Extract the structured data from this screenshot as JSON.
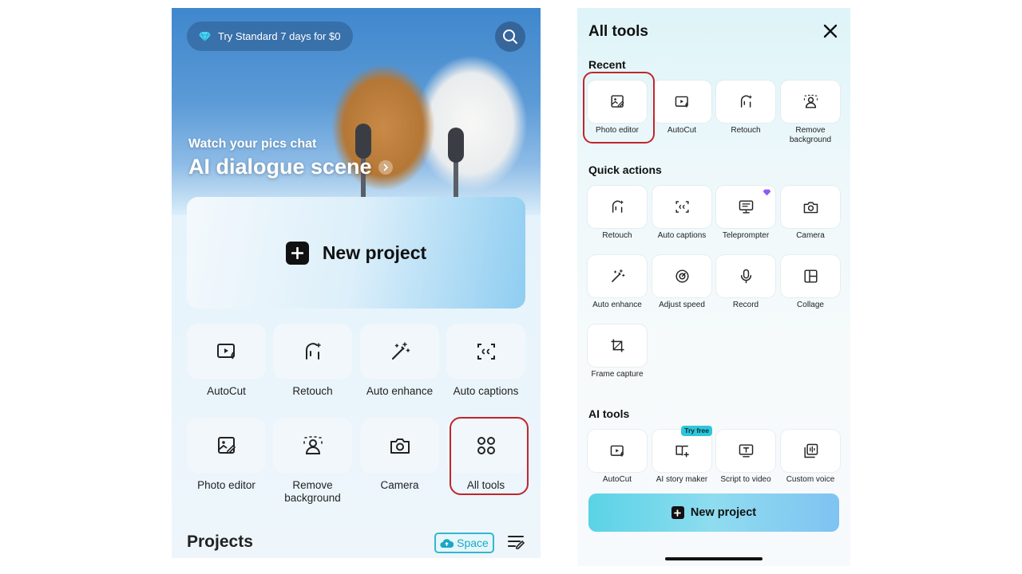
{
  "left": {
    "promo_text": "Try Standard 7 days for $0",
    "hero": {
      "subtitle": "Watch your pics chat",
      "title": "AI dialogue scene"
    },
    "new_project_label": "New project",
    "tools": [
      {
        "label": "AutoCut",
        "icon": "autocut-icon"
      },
      {
        "label": "Retouch",
        "icon": "retouch-icon"
      },
      {
        "label": "Auto enhance",
        "icon": "magic-wand-icon"
      },
      {
        "label": "Auto captions",
        "icon": "captions-icon"
      },
      {
        "label": "Photo editor",
        "icon": "photo-edit-icon"
      },
      {
        "label": "Remove background",
        "icon": "remove-bg-icon"
      },
      {
        "label": "Camera",
        "icon": "camera-icon"
      },
      {
        "label": "All tools",
        "icon": "grid-icon"
      }
    ],
    "projects_heading": "Projects",
    "space_label": "Space"
  },
  "right": {
    "title": "All tools",
    "sections": {
      "recent": "Recent",
      "quick_actions": "Quick actions",
      "ai_tools": "AI tools"
    },
    "recent": [
      {
        "label": "Photo editor",
        "icon": "photo-edit-icon"
      },
      {
        "label": "AutoCut",
        "icon": "autocut-icon"
      },
      {
        "label": "Retouch",
        "icon": "retouch-icon"
      },
      {
        "label": "Remove background",
        "icon": "remove-bg-icon"
      }
    ],
    "quick_actions": [
      {
        "label": "Retouch",
        "icon": "retouch-icon"
      },
      {
        "label": "Auto captions",
        "icon": "captions-icon"
      },
      {
        "label": "Teleprompter",
        "icon": "teleprompter-icon",
        "premium": true
      },
      {
        "label": "Camera",
        "icon": "camera-icon"
      },
      {
        "label": "Auto enhance",
        "icon": "magic-wand-icon"
      },
      {
        "label": "Adjust speed",
        "icon": "speed-icon"
      },
      {
        "label": "Record",
        "icon": "microphone-icon"
      },
      {
        "label": "Collage",
        "icon": "collage-icon"
      },
      {
        "label": "Frame capture",
        "icon": "frame-capture-icon"
      }
    ],
    "ai_tools": [
      {
        "label": "AutoCut",
        "icon": "autocut-icon"
      },
      {
        "label": "AI story maker",
        "icon": "story-maker-icon",
        "badge": "Try free"
      },
      {
        "label": "Script to video",
        "icon": "script-video-icon"
      },
      {
        "label": "Custom voice",
        "icon": "custom-voice-icon"
      }
    ],
    "new_project_label": "New project"
  },
  "colors": {
    "highlight": "#c0262c",
    "accent": "#36b6d0",
    "premium": "#8b5cf6"
  }
}
